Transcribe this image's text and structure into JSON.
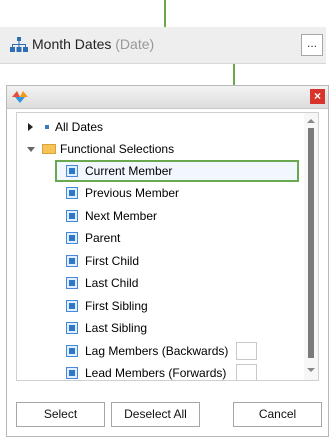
{
  "field": {
    "title": "Month Dates",
    "type_suffix": "(Date)",
    "more_label": "..."
  },
  "dialog": {
    "close_label": "×",
    "tree": {
      "root": "All Dates",
      "group": "Functional Selections",
      "members": [
        "Current Member",
        "Previous Member",
        "Next Member",
        "Parent",
        "First Child",
        "Last Child",
        "First Sibling",
        "Last Sibling",
        "Lag Members (Backwards)",
        "Lead Members (Forwards)"
      ],
      "selected": "Current Member"
    },
    "buttons": {
      "select": "Select",
      "deselect_all": "Deselect All",
      "cancel": "Cancel"
    }
  },
  "colors": {
    "callout": "#6aa84f",
    "close": "#d9342b",
    "member_icon": "#2f77c9"
  }
}
